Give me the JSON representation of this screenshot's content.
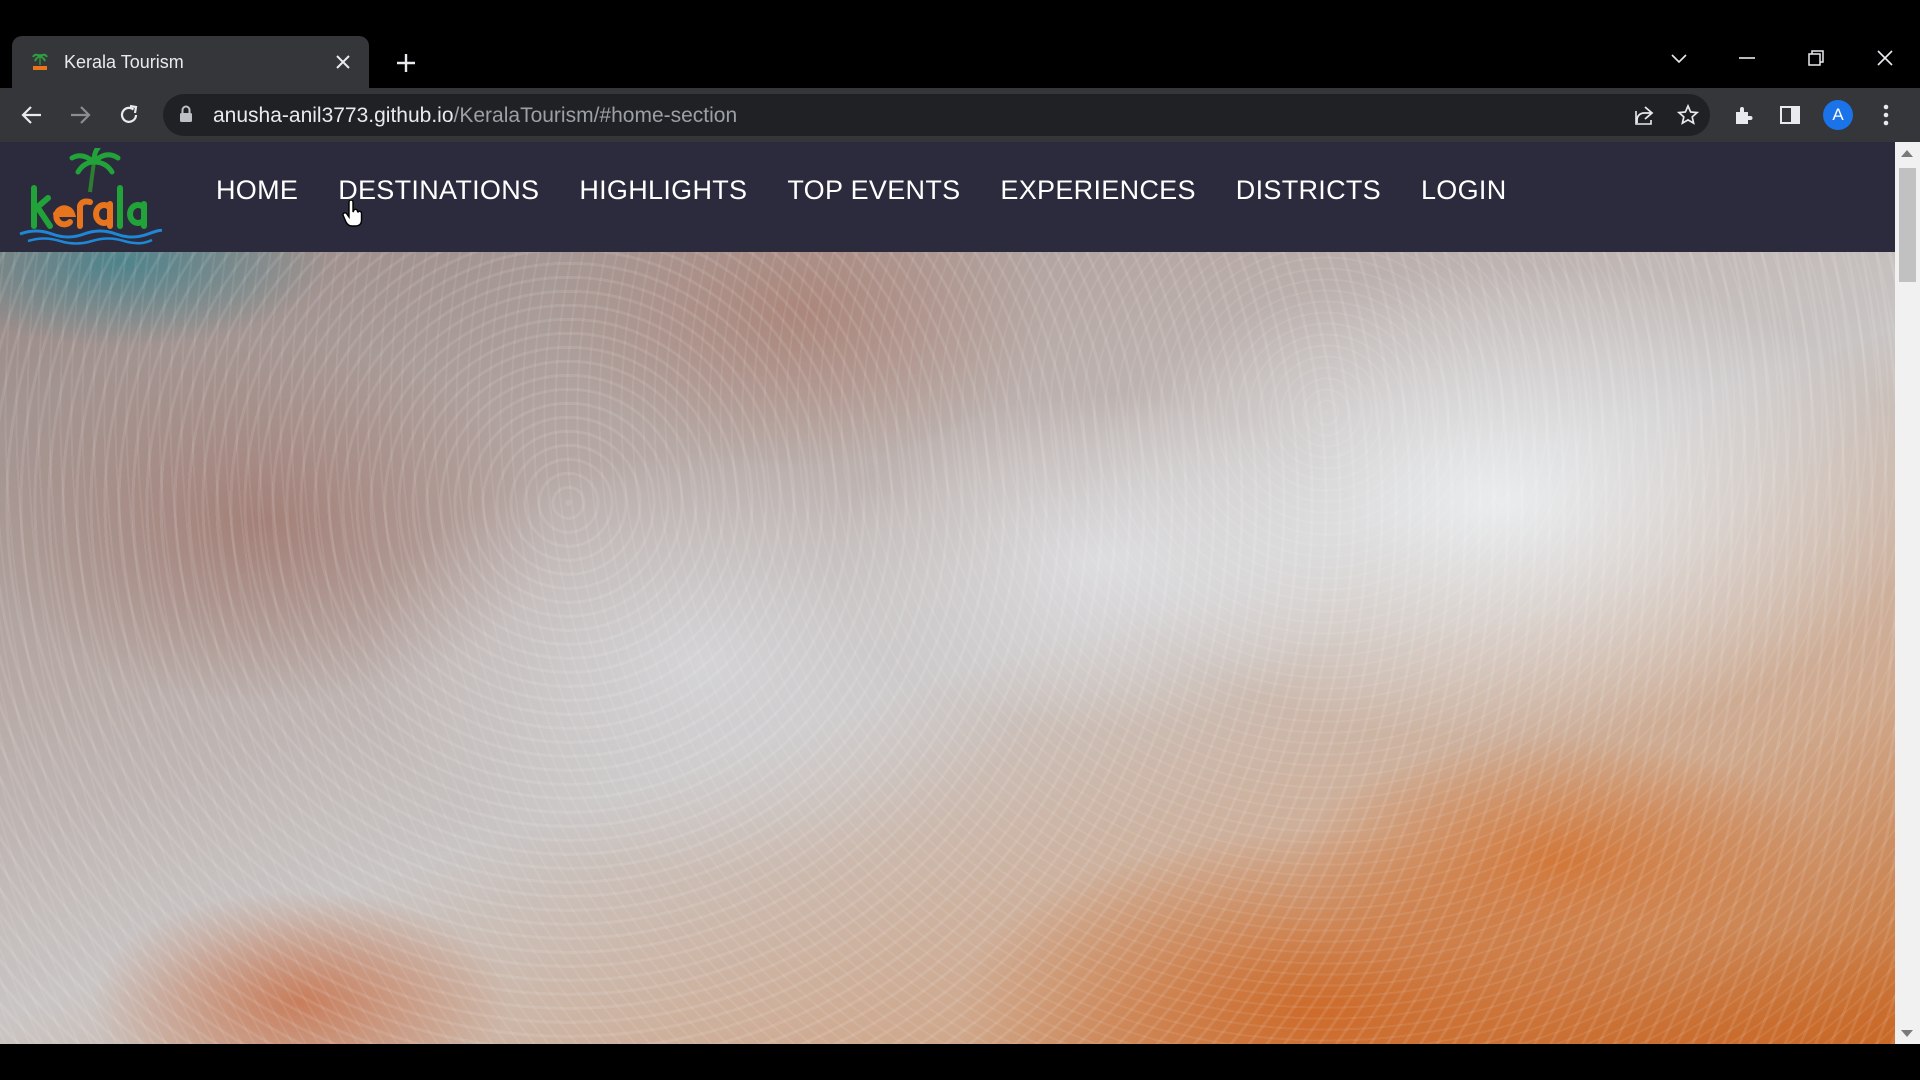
{
  "browser": {
    "tab_title": "Kerala Tourism",
    "url_host": "anusha-anil3773.github.io",
    "url_path": "/KeralaTourism/#home-section",
    "profile_initial": "A"
  },
  "site": {
    "logo_alt": "kerala",
    "menu": [
      "HOME",
      "DESTINATIONS",
      "HIGHLIGHTS",
      "TOP EVENTS",
      "EXPERIENCES",
      "DISTRICTS",
      "LOGIN"
    ]
  },
  "colors": {
    "chrome_dark": "#000000",
    "toolbar": "#35363a",
    "omnibox": "#202124",
    "site_nav": "#2b2b3d",
    "logo_green": "#22a33a",
    "logo_orange": "#e8741e",
    "logo_blue": "#1e88d6"
  },
  "icons": [
    "favicon-icon",
    "close-icon",
    "plus-icon",
    "chevron-down-icon",
    "minimize-icon",
    "restore-icon",
    "window-close-icon",
    "back-arrow-icon",
    "forward-arrow-icon",
    "reload-icon",
    "lock-icon",
    "share-icon",
    "star-icon",
    "extensions-icon",
    "side-panel-icon",
    "kebab-menu-icon",
    "hand-cursor-icon"
  ]
}
